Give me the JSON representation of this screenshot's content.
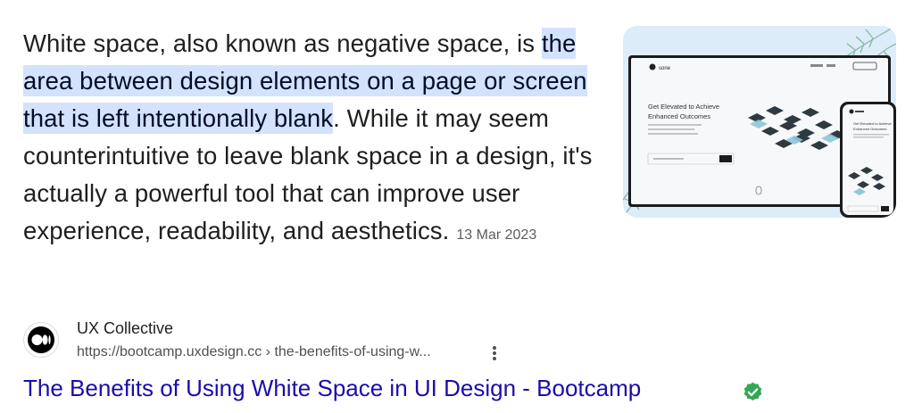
{
  "snippet": {
    "text_before": "White space, also known as negative space, is ",
    "highlight": "the area between design elements on a page or screen that is left intentionally blank",
    "text_after": ". While it may seem counterintuitive to leave blank space in a design, it's actually a powerful tool that can improve user experience, readability, and aesthetics.",
    "date": "13 Mar 2023"
  },
  "thumbnail": {
    "brand": "sone",
    "headline_line1": "Get Elevated to Achieve",
    "headline_line2": "Enhanced Outcomes",
    "phone_line1": "Get Elevated to Achieve",
    "phone_line2": "Enhanced Outcomes"
  },
  "source": {
    "site_name": "UX Collective",
    "url": "https://bootcamp.uxdesign.cc › the-benefits-of-using-w...",
    "more_icon": "more-vert-icon",
    "favicon": "medium-logo-icon"
  },
  "result": {
    "title": "The Benefits of Using White Space in UI Design - Bootcamp",
    "verified_icon": "verified-check-icon"
  },
  "colors": {
    "highlight": "#d3e3fd",
    "link": "#1a0dab",
    "verified": "#34a853"
  }
}
